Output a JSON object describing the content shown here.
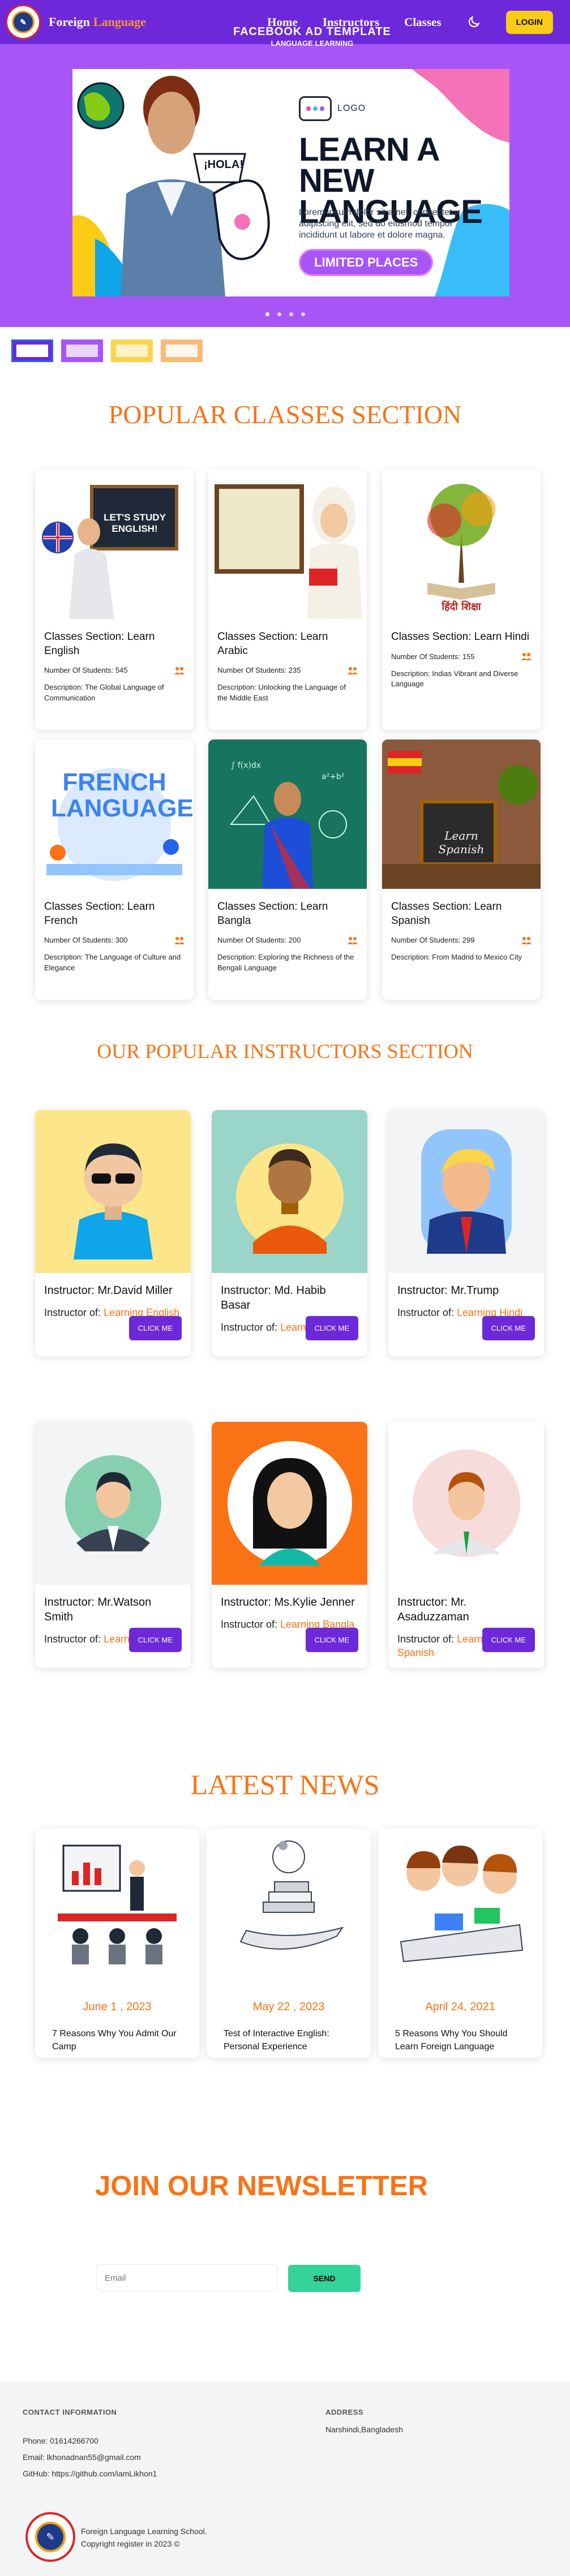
{
  "nav": {
    "brand_a": "Foreign",
    "brand_b": "Language",
    "links": [
      "Home",
      "Instructors",
      "Classes"
    ],
    "login": "LOGIN"
  },
  "hero": {
    "ad_line1": "FACEBOOK AD TEMPLATE",
    "ad_line2": "LANGUAGE LEARNING",
    "bubble": "¡HOLA!",
    "logo_text": "LOGO",
    "headline1": "LEARN A NEW",
    "headline2": "LANGUAGE",
    "body": "Lorem ipsum dolor sit amet, consectetur adipiscing elit, sed do eiusmod tempor incididunt ut labore et dolore magna.",
    "pill": "LIMITED PLACES"
  },
  "classes": {
    "title": "POPULAR CLASSES SECTION",
    "students_prefix": "Number Of Students:",
    "desc_prefix": "Description:",
    "items": [
      {
        "title": "Classes Section: Learn English",
        "students": "545",
        "desc": "The Global Language of Communication",
        "board": "LET'S STUDY ENGLISH!"
      },
      {
        "title": "Classes Section: Learn Arabic",
        "students": "235",
        "desc": "Unlocking the Language of the Middle East",
        "board": ""
      },
      {
        "title": "Classes Section: Learn Hindi",
        "students": "155",
        "desc": "Indias Vibrant and Diverse Language",
        "board": "हिंदी शिक्षा"
      },
      {
        "title": "Classes Section: Learn French",
        "students": "300",
        "desc": "The Language of Culture and Elegance",
        "board": "FRENCH LANGUAGE"
      },
      {
        "title": "Classes Section: Learn Bangla",
        "students": "200",
        "desc": "Exploring the Richness of the Bengali Language",
        "board": ""
      },
      {
        "title": "Classes Section: Learn Spanish",
        "students": "299",
        "desc": "From Madrid to Mexico City",
        "board": "Learn Spanish"
      }
    ]
  },
  "instructors": {
    "title": "OUR POPULAR INSTRUCTORS SECTION",
    "of_label": "Instructor of:",
    "button": "CLICK ME",
    "items": [
      {
        "name": "Instructor: Mr.David Miller",
        "lang": "Learning English"
      },
      {
        "name": "Instructor: Md. Habib Basar",
        "lang": "Learning Arabic"
      },
      {
        "name": "Instructor: Mr.Trump",
        "lang": "Learning Hindi"
      },
      {
        "name": "Instructor: Mr.Watson Smith",
        "lang": "Learning French"
      },
      {
        "name": "Instructor: Ms.Kylie Jenner",
        "lang": "Learning Bangla"
      },
      {
        "name": "Instructor: Mr. Asaduzzaman",
        "lang": "Learning Spanish"
      }
    ]
  },
  "news": {
    "title": "LATEST NEWS",
    "items": [
      {
        "date": "June 1 , 2023",
        "title": "7 Reasons Why You Admit Our Camp"
      },
      {
        "date": "May 22 , 2023",
        "title": "Test of Interactive English: Personal Experience"
      },
      {
        "date": "April 24, 2021",
        "title": "5 Reasons Why You Should Learn Foreign Language"
      }
    ]
  },
  "newsletter": {
    "title": "JOIN OUR NEWSLETTER",
    "placeholder": "Email",
    "button": "SEND"
  },
  "footer": {
    "contact_head": "CONTACT INFORMATION",
    "phone": "Phone: 01614266700",
    "email": "Email: lkhonadnan55@gmail.com",
    "github": "GitHub: https://github.com/iamLikhon1",
    "address_head": "ADDRESS",
    "address": "Narshindi,Bangladesh",
    "school": "Foreign Language Learning School.",
    "copyright": "Copyright register in 2023 ©"
  },
  "colors": {
    "nav_bg": "#6d28d9",
    "hero_bg": "#a855f7",
    "accent_orange": "#f97316",
    "button_purple": "#6d28d9",
    "send_green": "#34d399",
    "login_yellow": "#facc15"
  }
}
